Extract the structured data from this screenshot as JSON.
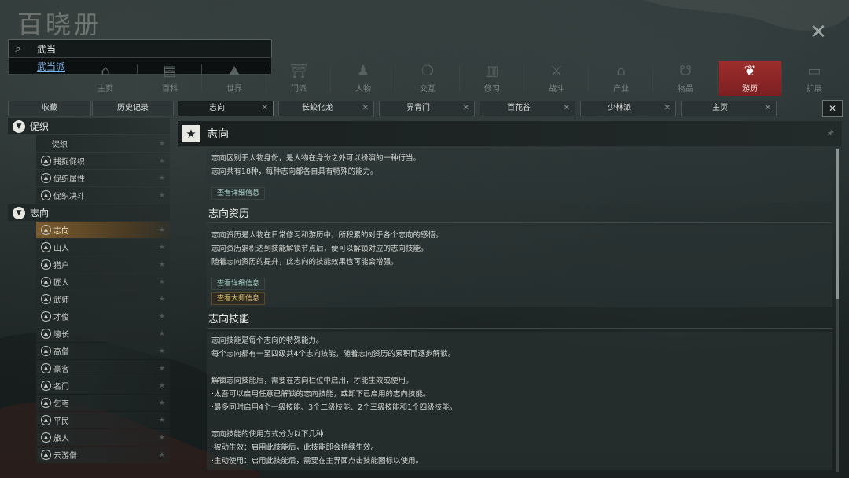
{
  "app": {
    "title": "百晓册",
    "close_icon": "close-icon"
  },
  "search": {
    "value": "武当",
    "suggestion": "武当派"
  },
  "nav": [
    {
      "label": "主页",
      "icon": "home-icon",
      "active": false
    },
    {
      "label": "百科",
      "icon": "book-icon",
      "active": false
    },
    {
      "label": "世界",
      "icon": "mountain-icon",
      "active": false
    },
    {
      "label": "门派",
      "icon": "temple-icon",
      "active": false
    },
    {
      "label": "人物",
      "icon": "person-icon",
      "active": false
    },
    {
      "label": "交互",
      "icon": "chat-icon",
      "active": false
    },
    {
      "label": "修习",
      "icon": "scroll-icon",
      "active": false
    },
    {
      "label": "战斗",
      "icon": "crossed-swords-icon",
      "active": false
    },
    {
      "label": "产业",
      "icon": "building-icon",
      "active": false
    },
    {
      "label": "物品",
      "icon": "gourd-icon",
      "active": false
    },
    {
      "label": "游历",
      "icon": "butterfly-icon",
      "active": true
    },
    {
      "label": "扩展",
      "icon": "chest-icon",
      "active": false
    }
  ],
  "left_tabs": {
    "favorites": "收藏",
    "history": "历史记录"
  },
  "tabs": [
    {
      "label": "志向",
      "active": true
    },
    {
      "label": "长蛟化龙",
      "active": false
    },
    {
      "label": "界青门",
      "active": false
    },
    {
      "label": "百花谷",
      "active": false
    },
    {
      "label": "少林派",
      "active": false
    },
    {
      "label": "主页",
      "active": false
    }
  ],
  "sidebar": {
    "categories": [
      {
        "label": "促织",
        "items": [
          {
            "label": "促织",
            "dot": false,
            "active": false
          },
          {
            "label": "捕捉促织",
            "dot": true,
            "active": false
          },
          {
            "label": "促织属性",
            "dot": true,
            "active": false
          },
          {
            "label": "促织决斗",
            "dot": true,
            "active": false
          }
        ]
      },
      {
        "label": "志向",
        "items": [
          {
            "label": "志向",
            "dot": true,
            "active": true
          },
          {
            "label": "山人",
            "dot": true,
            "active": false
          },
          {
            "label": "猎户",
            "dot": true,
            "active": false
          },
          {
            "label": "匠人",
            "dot": true,
            "active": false
          },
          {
            "label": "武师",
            "dot": true,
            "active": false
          },
          {
            "label": "才俊",
            "dot": true,
            "active": false
          },
          {
            "label": "壕长",
            "dot": true,
            "active": false
          },
          {
            "label": "高僧",
            "dot": true,
            "active": false
          },
          {
            "label": "豪客",
            "dot": true,
            "active": false
          },
          {
            "label": "名门",
            "dot": true,
            "active": false
          },
          {
            "label": "乞丐",
            "dot": true,
            "active": false
          },
          {
            "label": "平民",
            "dot": true,
            "active": false
          },
          {
            "label": "旅人",
            "dot": true,
            "active": false
          },
          {
            "label": "云游僧",
            "dot": true,
            "active": false
          }
        ]
      }
    ]
  },
  "main": {
    "title": "志向",
    "intro": [
      "志向区别于人物身份，是人物在身份之外可以扮演的一种行当。",
      "志向共有18种，每种志向都各自具有特殊的能力。"
    ],
    "intro_more": "查看详细信息",
    "sections": [
      {
        "title": "志向资历",
        "paras": [
          "志向资历是人物在日常修习和游历中，所积累的对于各个志向的感悟。",
          "志向资历累积达到技能解锁节点后，便可以解锁对应的志向技能。",
          "随着志向资历的提升，此志向的技能效果也可能会增强。"
        ],
        "buttons": [
          {
            "label": "查看详细信息",
            "gold": false
          },
          {
            "label": "查看大师信息",
            "gold": true
          }
        ]
      },
      {
        "title": "志向技能",
        "paras": [
          "志向技能是每个志向的特殊能力。",
          "每个志向都有一至四级共4个志向技能，随着志向资历的累积而逐步解锁。",
          "",
          "解锁志向技能后，需要在志向栏位中启用，才能生效或使用。",
          "·太吾可以启用任意已解锁的志向技能，或卸下已启用的志向技能。",
          "·最多同时启用4个一级技能、3个二级技能、2个三级技能和1个四级技能。",
          "",
          "志向技能的使用方式分为以下几种：",
          "·被动生效：启用此技能后，此技能即会持续生效。",
          "·主动使用：启用此技能后，需要在主界面点击技能图标以使用。"
        ],
        "buttons": []
      }
    ]
  }
}
